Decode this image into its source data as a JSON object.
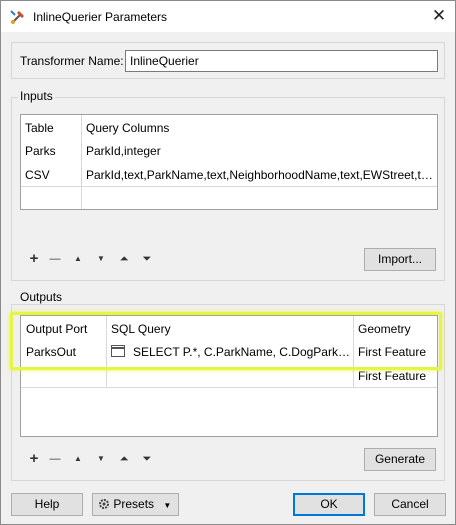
{
  "window": {
    "title": "InlineQuerier Parameters",
    "close": "✕"
  },
  "transformer": {
    "label": "Transformer Name:",
    "value": "InlineQuerier"
  },
  "inputs": {
    "group_label": "Inputs",
    "headers": [
      "Table",
      "Query Columns"
    ],
    "rows": [
      [
        "Parks",
        "ParkId,integer"
      ],
      [
        "CSV",
        "ParkId,text,ParkName,text,NeighborhoodName,text,EWStreet,tex..."
      ]
    ],
    "import_label": "Import..."
  },
  "outputs": {
    "group_label": "Outputs",
    "headers": [
      "Output Port",
      "SQL Query",
      "Geometry"
    ],
    "rows": [
      [
        "ParksOut",
        "SELECT P.*, C.ParkName, C.DogPark, C....",
        "First Feature"
      ],
      [
        "",
        "",
        "First Feature"
      ]
    ],
    "generate_label": "Generate"
  },
  "toolbar": {
    "add": "+",
    "remove": "—",
    "up": "▲",
    "down": "▼",
    "top": "⏶",
    "bottom": "⏷"
  },
  "footer": {
    "help": "Help",
    "presets": "Presets",
    "ok": "OK",
    "cancel": "Cancel"
  },
  "colors": {
    "highlight": "#e6f542",
    "ok_border": "#0078d7"
  }
}
